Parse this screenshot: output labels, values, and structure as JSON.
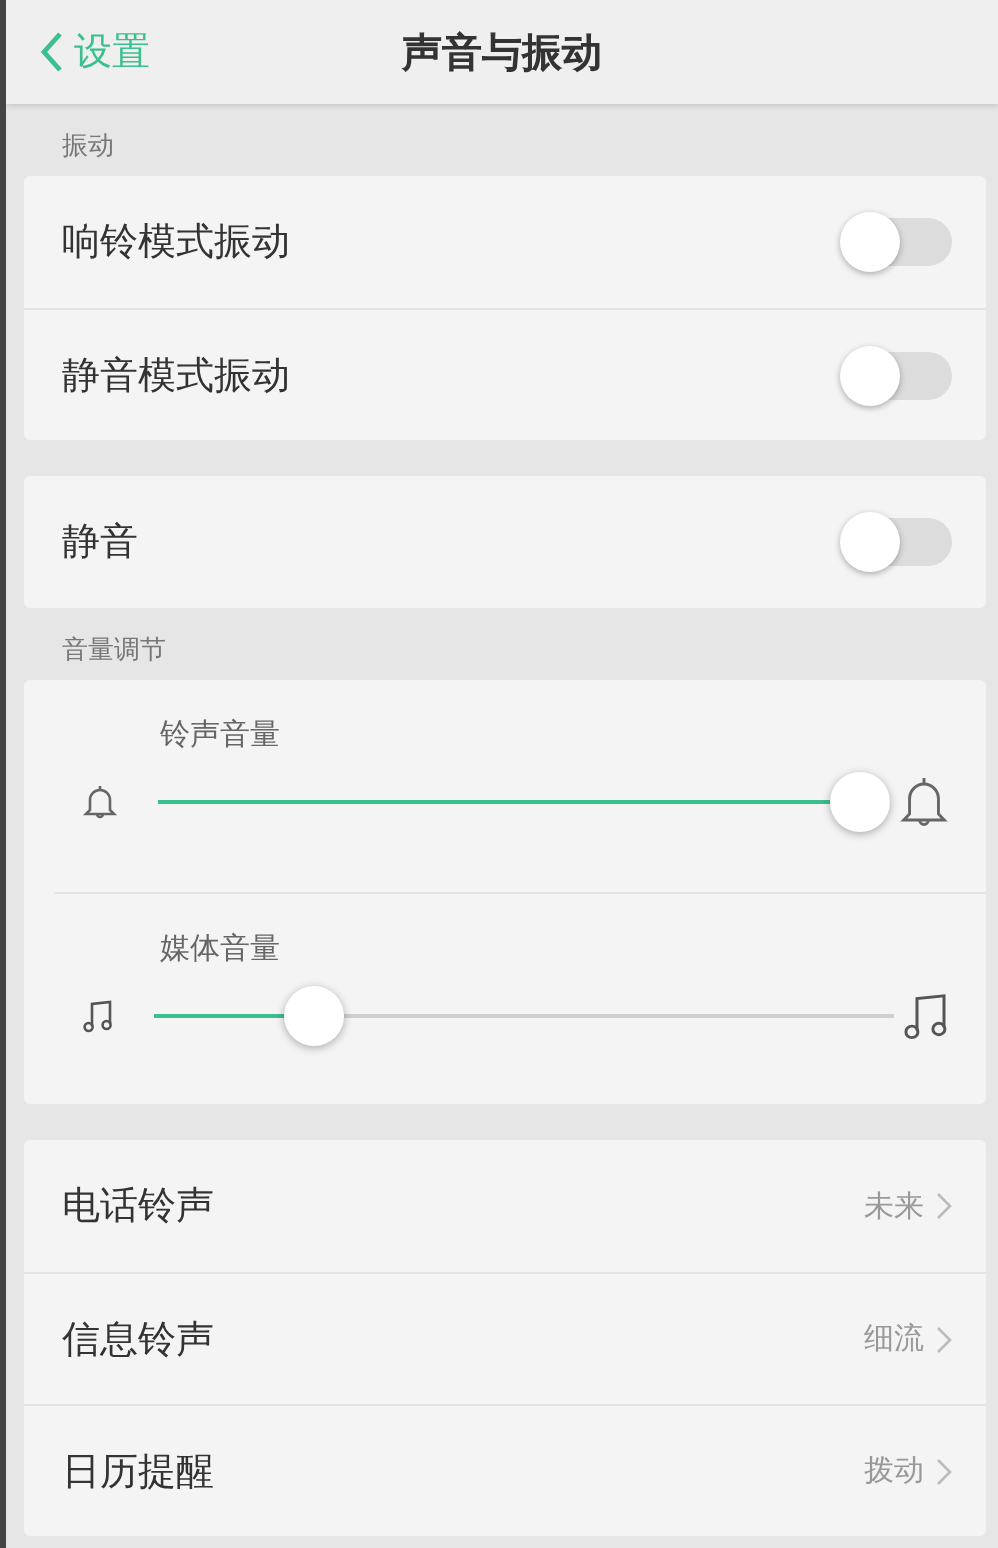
{
  "header": {
    "back_label": "设置",
    "title": "声音与振动"
  },
  "sections": [
    {
      "label": "振动",
      "kind": "toggles",
      "items": [
        {
          "label": "响铃模式振动",
          "on": false
        },
        {
          "label": "静音模式振动",
          "on": false
        }
      ]
    },
    {
      "kind": "toggles",
      "items": [
        {
          "label": "静音",
          "on": false
        }
      ]
    },
    {
      "label": "音量调节",
      "kind": "sliders",
      "items": [
        {
          "label": "铃声音量",
          "level": 1
        },
        {
          "label": "媒体音量",
          "level": 0.19
        }
      ]
    },
    {
      "kind": "links",
      "items": [
        {
          "label": "电话铃声",
          "value": "未来"
        },
        {
          "label": "信息铃声",
          "value": "细流"
        },
        {
          "label": "日历提醒",
          "value": "拨动"
        }
      ]
    }
  ]
}
